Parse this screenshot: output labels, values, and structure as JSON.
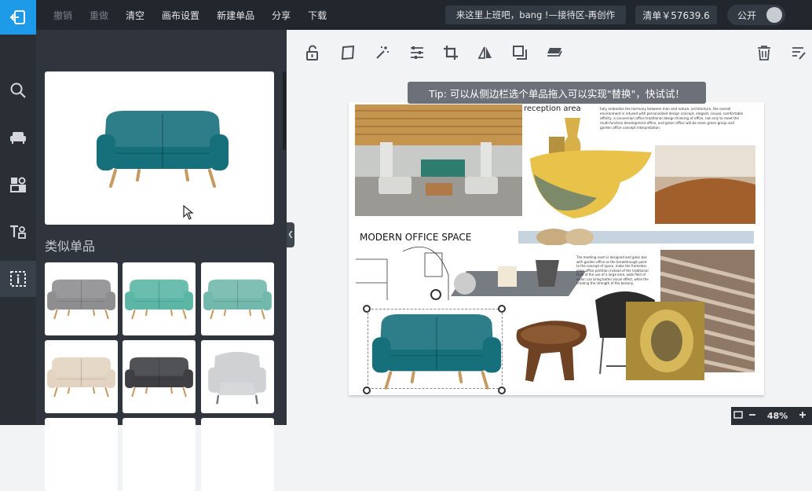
{
  "toolbar": {
    "undo": "撤销",
    "redo": "重做",
    "clear": "清空",
    "canvas_settings": "画布设置",
    "new_item": "新建单品",
    "share": "分享",
    "download": "下载",
    "project_title": "来这里上班吧，bang !—接待区-再创作",
    "price": "清单￥57639.6",
    "public_label": "公开"
  },
  "sidebar": {
    "similar_title": "类似单品"
  },
  "tip": "Tip: 可以从侧边栏选个单品拖入可以实现\"替换\"，快试试！",
  "board": {
    "reception_label": "reception area",
    "heading": "MODERN OFFICE SPACE",
    "paragraph_top": "fully embodies the harmony between man and nature, architecture, the overall environment is infused with personalized design concept, elegant, casual, comfortable affinity, a conversion office traditional design thinking of office, not only to meet the multi-function development office, and green office will be more green group and garden office concept interpretation.",
    "paragraph_mid": "The meeting room is designed and glass box with garden office as the breakthrough point to the concept of space, make the frameless glass office partition instead of the traditional form of the use of a large area, wide field of vision can bring better visual effect, while the creating the strength of the balcony."
  },
  "zoom": {
    "level": "48%"
  },
  "colors": {
    "accent": "#1e9be8",
    "topbar": "#22272e",
    "sofa_teal": "#16707c"
  }
}
